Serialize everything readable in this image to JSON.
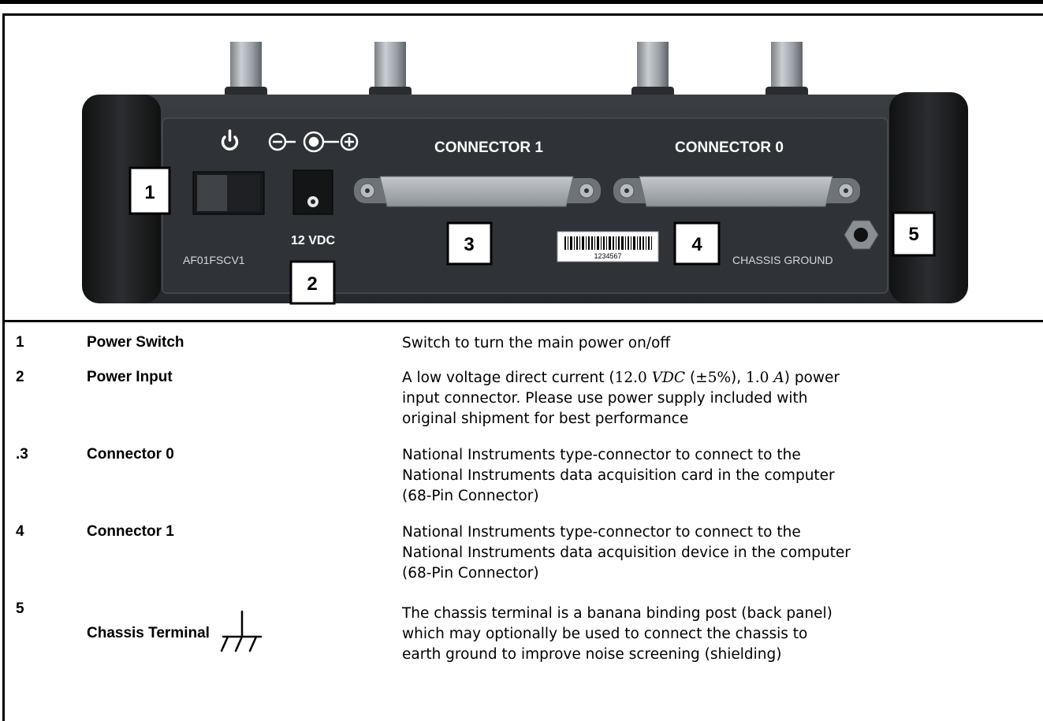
{
  "figure": {
    "icons": [
      "power-icon",
      "polarity-icon"
    ],
    "labels": {
      "connector1": "CONNECTOR 1",
      "connector0": "CONNECTOR 0",
      "vdc": "12 VDC",
      "model": "AF01FSCV1",
      "serial": "1234567",
      "chassis_ground": "CHASSIS GROUND"
    },
    "callouts": [
      "1",
      "2",
      "3",
      "4",
      "5"
    ]
  },
  "rows": [
    {
      "num": "1",
      "name": "Power Switch",
      "desc": [
        "Switch to turn the main power on/off"
      ]
    },
    {
      "num": "2",
      "name": "Power Input",
      "desc_line1": {
        "pre": "A low voltage direct current (",
        "v1": "12.0",
        "u1": "VDC",
        "mid1": " (",
        "pm": "±5%",
        "mid2": "), ",
        "v2": "1.0",
        "u2": "A",
        "post": ") power"
      },
      "desc": [
        "input connector.  Please use power supply included with",
        "original shipment for best performance"
      ]
    },
    {
      "num": ".3",
      "name": "Connector 0",
      "desc": [
        "National Instruments type-connector to connect to the",
        "National Instruments data acquisition card in the computer",
        "(68-Pin Connector)"
      ]
    },
    {
      "num": "4",
      "name": "Connector 1",
      "desc": [
        "National Instruments type-connector to connect to the",
        "National Instruments data acquisition device in the computer",
        "(68-Pin Connector)"
      ]
    },
    {
      "num": "5",
      "name": "Chassis Terminal",
      "icon": "chassis-ground-icon",
      "desc": [
        "The chassis terminal is a banana binding post (back panel)",
        "which may optionally be used to connect the chassis to",
        "earth ground to improve noise screening (shielding)"
      ]
    }
  ]
}
